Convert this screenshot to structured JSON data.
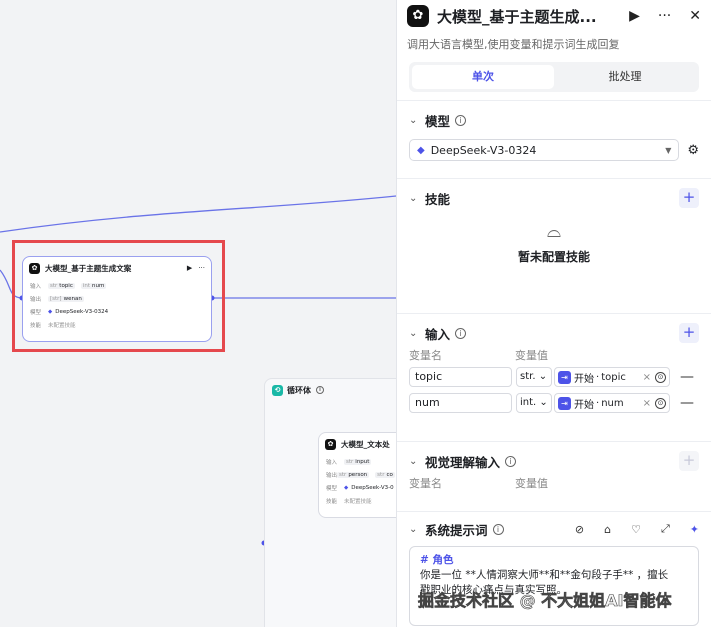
{
  "canvas": {
    "main_node": {
      "title": "大模型_基于主题生成文案",
      "input_label": "输入",
      "inputs": [
        {
          "type": "str",
          "name": "topic"
        },
        {
          "type": "int",
          "name": "num"
        }
      ],
      "output_label": "输出",
      "output": {
        "type": "[str]",
        "name": "wenan"
      },
      "model_label": "模型",
      "model": "DeepSeek-V3-0324",
      "skill_label": "技能",
      "skill_value": "未配置技能"
    },
    "loop_node": {
      "title": "循环体"
    },
    "inner_node": {
      "title": "大模型_文本处",
      "input_label": "输入",
      "inputs": [
        {
          "type": "str",
          "name": "input"
        }
      ],
      "output_label": "输出",
      "outputs": [
        {
          "type": "str",
          "name": "person"
        },
        {
          "type": "str",
          "name": "co"
        }
      ],
      "model_label": "模型",
      "model": "DeepSeek-V3-0",
      "skill_label": "技能",
      "skill_value": "未配置技能"
    }
  },
  "panel": {
    "title": "大模型_基于主题生成...",
    "description": "调用大语言模型,使用变量和提示词生成回复",
    "tabs": [
      {
        "label": "单次",
        "active": true
      },
      {
        "label": "批处理",
        "active": false
      }
    ],
    "model_section": {
      "title": "模型",
      "selected": "DeepSeek-V3-0324"
    },
    "skills_section": {
      "title": "技能",
      "empty_text": "暂未配置技能"
    },
    "input_section": {
      "title": "输入",
      "col_name": "变量名",
      "col_value": "变量值",
      "rows": [
        {
          "name": "topic",
          "type": "str.",
          "source": "开始",
          "ref": "topic"
        },
        {
          "name": "num",
          "type": "int.",
          "source": "开始",
          "ref": "num"
        }
      ]
    },
    "vision_section": {
      "title": "视觉理解输入",
      "col_name": "变量名",
      "col_value": "变量值"
    },
    "prompt_section": {
      "title": "系统提示词",
      "heading": "# 角色",
      "line1": "你是一位 **人情洞察大师**和**金句段子手** ，擅长",
      "line2": "戳职业的核心痛点与真实写照。"
    }
  },
  "watermark": "掘金技术社区 @ 不大姐姐AI智能体",
  "colors": {
    "accent": "#4d53e8",
    "highlight": "#e5484d",
    "loop": "#19b8a6"
  }
}
